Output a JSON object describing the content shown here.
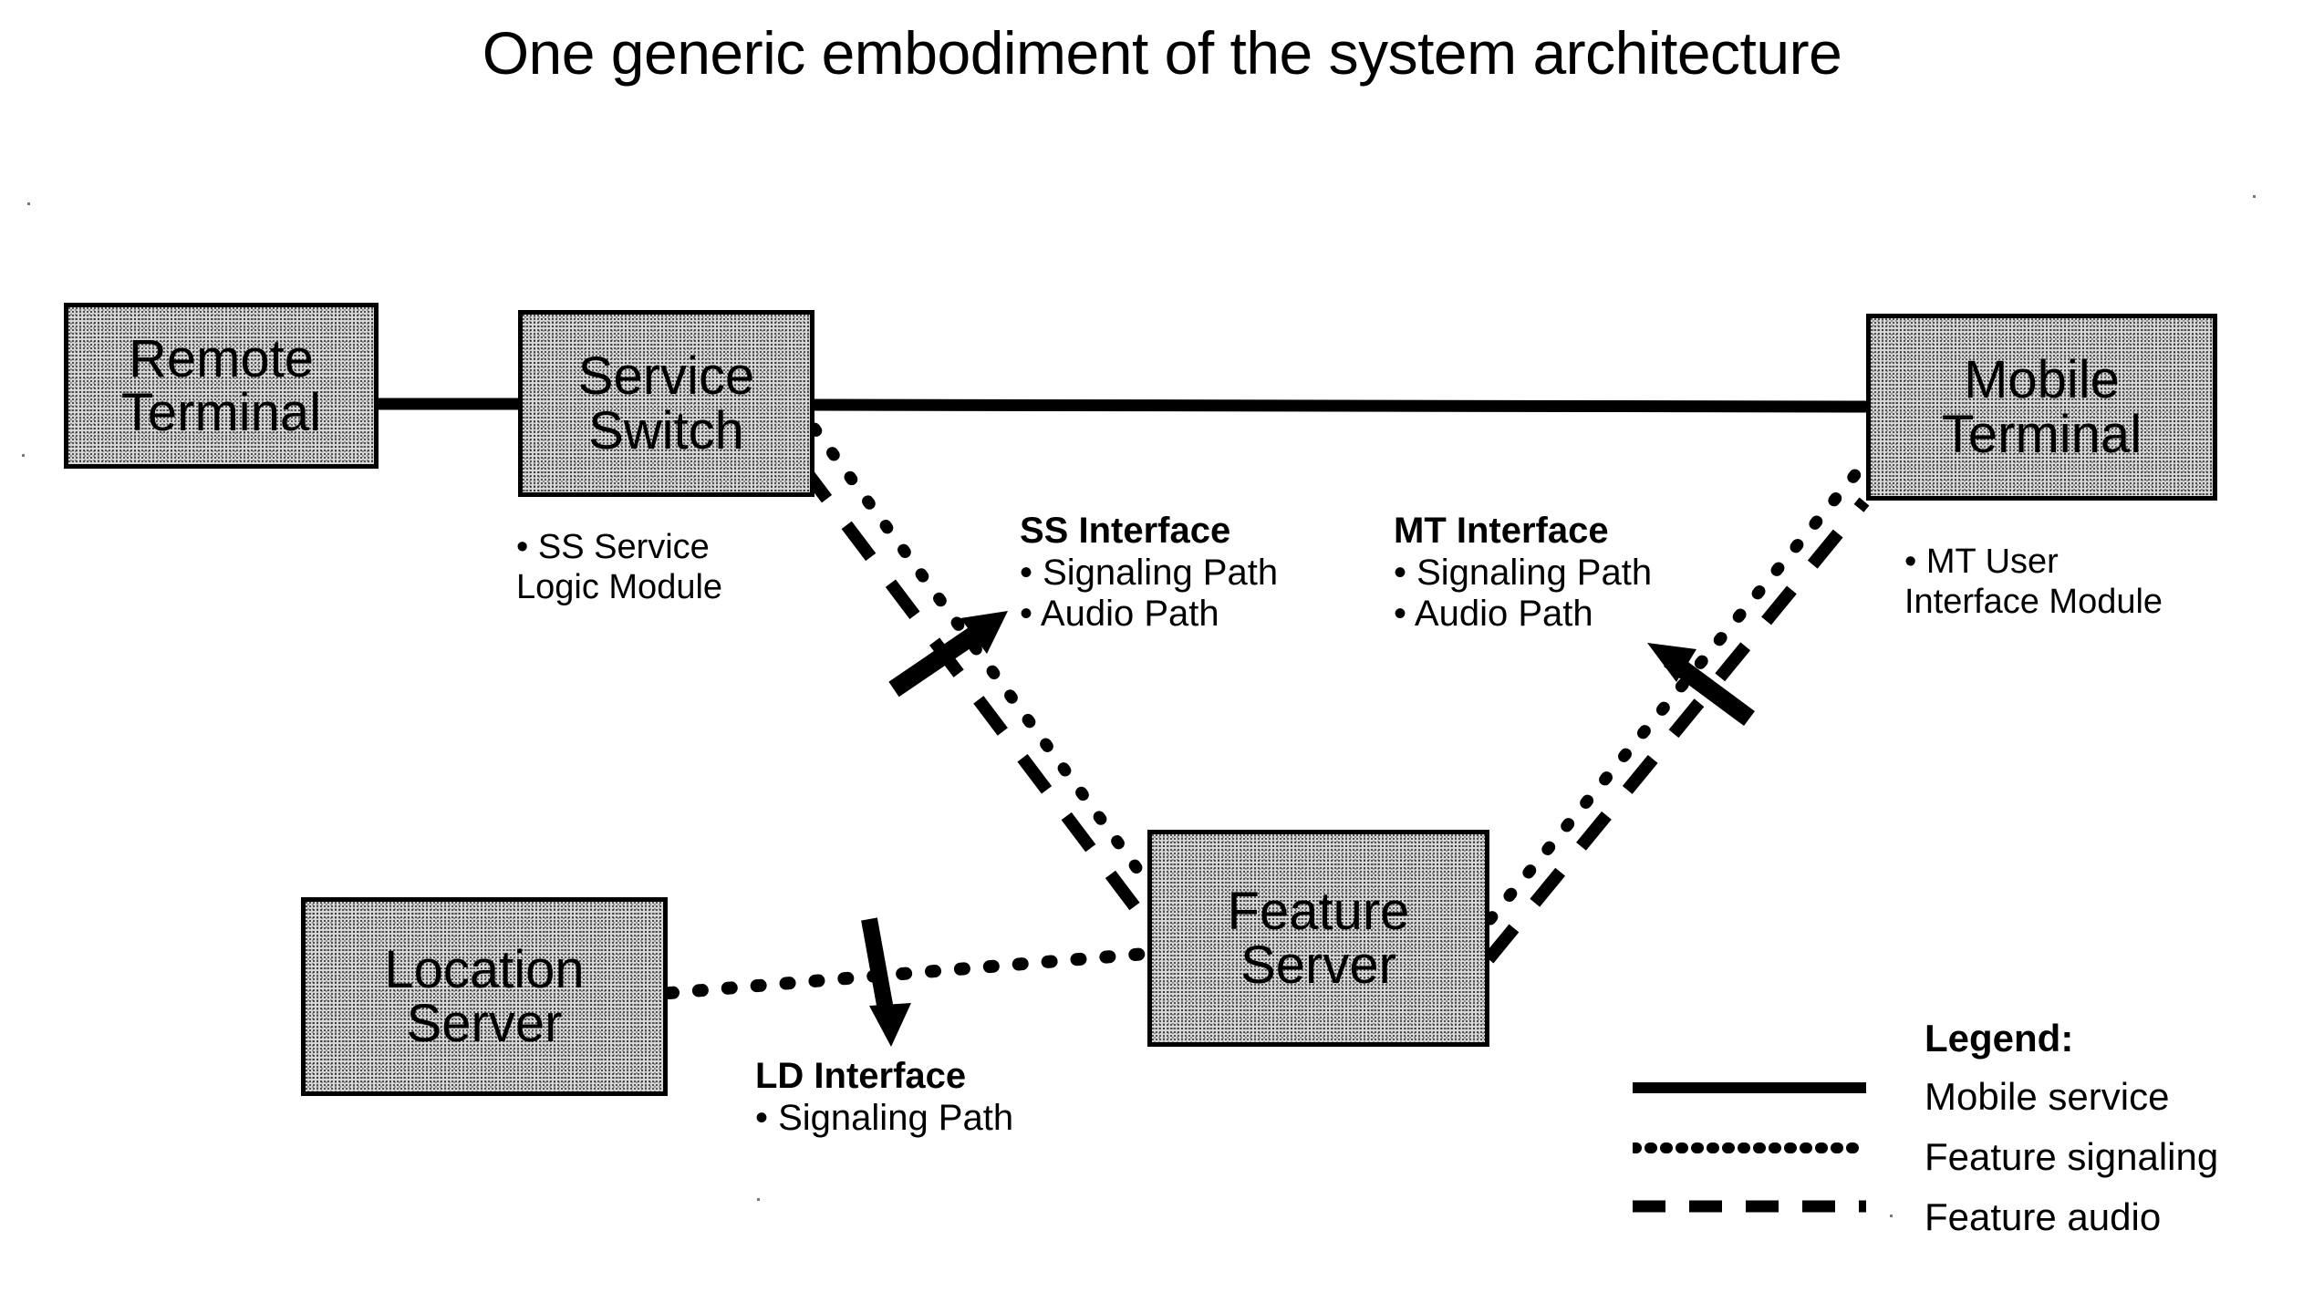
{
  "title": "One generic embodiment of the system architecture",
  "nodes": {
    "remote_terminal": {
      "line1": "Remote",
      "line2": "Terminal"
    },
    "service_switch": {
      "line1": "Service",
      "line2": "Switch"
    },
    "mobile_terminal": {
      "line1": "Mobile",
      "line2": "Terminal"
    },
    "feature_server": {
      "line1": "Feature",
      "line2": "Server"
    },
    "location_server": {
      "line1": "Location",
      "line2": "Server"
    }
  },
  "annotations": {
    "ss_module": {
      "line1": "• SS Service",
      "line2": "Logic Module"
    },
    "ss_interface": {
      "header": "SS Interface",
      "item1": "• Signaling Path",
      "item2": "• Audio Path"
    },
    "mt_interface": {
      "header": "MT Interface",
      "item1": "• Signaling Path",
      "item2": "• Audio Path"
    },
    "mt_module": {
      "line1": "• MT User",
      "line2": "Interface Module"
    },
    "ld_interface": {
      "header": "LD Interface",
      "item1": "• Signaling Path"
    }
  },
  "legend": {
    "title": "Legend:",
    "entries": [
      {
        "style": "solid",
        "label": "Mobile service"
      },
      {
        "style": "dotted",
        "label": "Feature signaling"
      },
      {
        "style": "dashed",
        "label": "Feature audio"
      }
    ]
  },
  "colors": {
    "stroke": "#000000",
    "box_fill": "#d7d7d7",
    "background": "#ffffff"
  }
}
